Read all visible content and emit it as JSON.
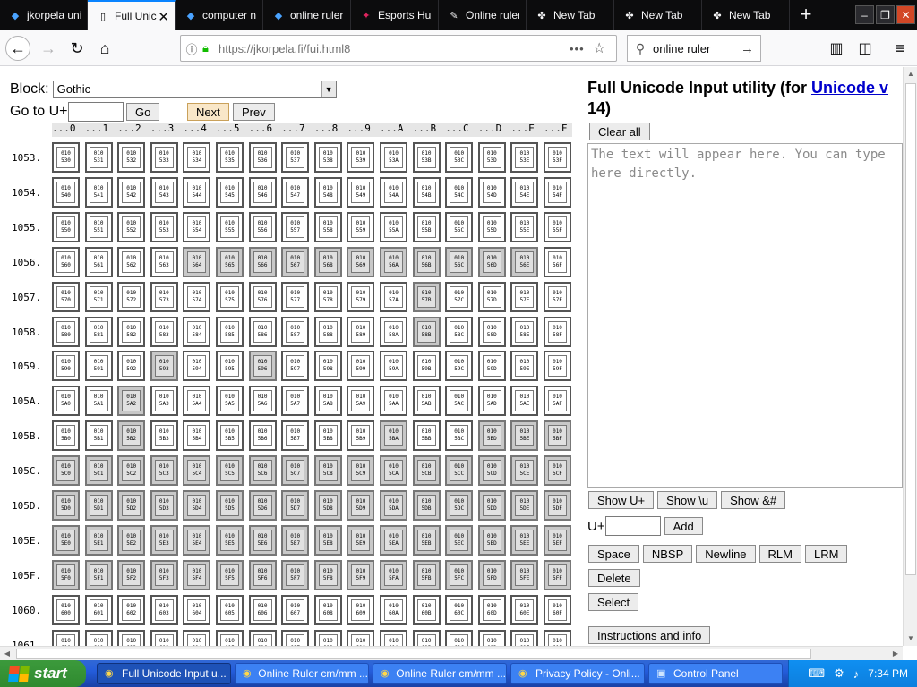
{
  "tabs": [
    {
      "label": "jkorpela uni",
      "icon": "firefox-search-icon",
      "active": false
    },
    {
      "label": "Full Unic",
      "icon": "page-icon",
      "active": true
    },
    {
      "label": "computer ne",
      "icon": "firefox-search-icon",
      "active": false
    },
    {
      "label": "online ruler",
      "icon": "firefox-search-icon",
      "active": false
    },
    {
      "label": "Esports Hub",
      "icon": "esports-icon",
      "active": false
    },
    {
      "label": "Online ruler",
      "icon": "ruler-icon",
      "active": false
    },
    {
      "label": "New Tab",
      "icon": "newtab-icon",
      "active": false
    },
    {
      "label": "New Tab",
      "icon": "newtab-icon",
      "active": false
    },
    {
      "label": "New Tab",
      "icon": "newtab-icon",
      "active": false
    }
  ],
  "newtab_symbol": "+",
  "window": {
    "minimize": "–",
    "restore": "❐",
    "close": "✕"
  },
  "nav": {
    "url": "https://jkorpela.fi/fui.html8",
    "search_value": "online ruler"
  },
  "page": {
    "block_label": "Block:",
    "block_value": "Gothic",
    "goto_label": "Go to U+",
    "go_button": "Go",
    "next_button": "Next",
    "prev_button": "Prev",
    "title_prefix": "Full Unicode Input utility (for ",
    "title_link": "Unicode v",
    "title_line2": "14)",
    "clear_button": "Clear all",
    "textarea_placeholder": "The text will appear here. You can type here directly.",
    "show_buttons": [
      "Show U+",
      "Show \\u",
      "Show &#"
    ],
    "u_label": "U+",
    "add_button": "Add",
    "space_buttons": [
      "Space",
      "NBSP",
      "Newline",
      "RLM",
      "LRM"
    ],
    "delete_button": "Delete",
    "select_button": "Select",
    "info_button": "Instructions and info"
  },
  "grid": {
    "columns": [
      "...0",
      "...1",
      "...2",
      "...3",
      "...4",
      "...5",
      "...6",
      "...7",
      "...8",
      "...9",
      "...A",
      "...B",
      "...C",
      "...D",
      "...E",
      "...F"
    ],
    "rows": [
      "1053.",
      "1054.",
      "1055.",
      "1056.",
      "1057.",
      "1058.",
      "1059.",
      "105A.",
      "105B.",
      "105C.",
      "105D.",
      "105E.",
      "105F.",
      "1060.",
      "1061."
    ],
    "row_codes": [
      "53",
      "54",
      "55",
      "56",
      "57",
      "58",
      "59",
      "5A",
      "5B",
      "5C",
      "5D",
      "5E",
      "5F",
      "60",
      "61"
    ],
    "plane_label": "010",
    "shaded": {
      "3": [
        4,
        5,
        6,
        7,
        8,
        9,
        10,
        11,
        12,
        13,
        14
      ],
      "4": [
        11
      ],
      "5": [
        11
      ],
      "6": [
        3,
        6
      ],
      "7": [
        2
      ],
      "8": [
        2,
        10,
        13,
        14,
        15
      ],
      "9": [
        0,
        1,
        2,
        3,
        4,
        5,
        6,
        7,
        8,
        9,
        10,
        11,
        12,
        13,
        14,
        15
      ],
      "10": [
        0,
        1,
        2,
        3,
        4,
        5,
        6,
        7,
        8,
        9,
        10,
        11,
        12,
        13,
        14,
        15
      ],
      "11": [
        0,
        1,
        2,
        3,
        4,
        5,
        6,
        7,
        8,
        9,
        10,
        11,
        12,
        13,
        14,
        15
      ],
      "12": [
        0,
        1,
        2,
        3,
        4,
        5,
        6,
        7,
        8,
        9,
        10,
        11,
        12,
        13,
        14,
        15
      ]
    }
  },
  "taskbar": {
    "start_label": "start",
    "items": [
      {
        "label": "Full Unicode Input u...",
        "active": true
      },
      {
        "label": "Online Ruler cm/mm ...",
        "active": false
      },
      {
        "label": "Online Ruler cm/mm ...",
        "active": false
      },
      {
        "label": "Privacy Policy - Onli...",
        "active": false
      },
      {
        "label": "Control Panel",
        "active": false
      }
    ],
    "clock": "7:34 PM"
  },
  "colors": {
    "accent": "#0a84ff",
    "link": "#0000cc",
    "taskbar": "#245ddb",
    "start": "#2f8a2f"
  }
}
